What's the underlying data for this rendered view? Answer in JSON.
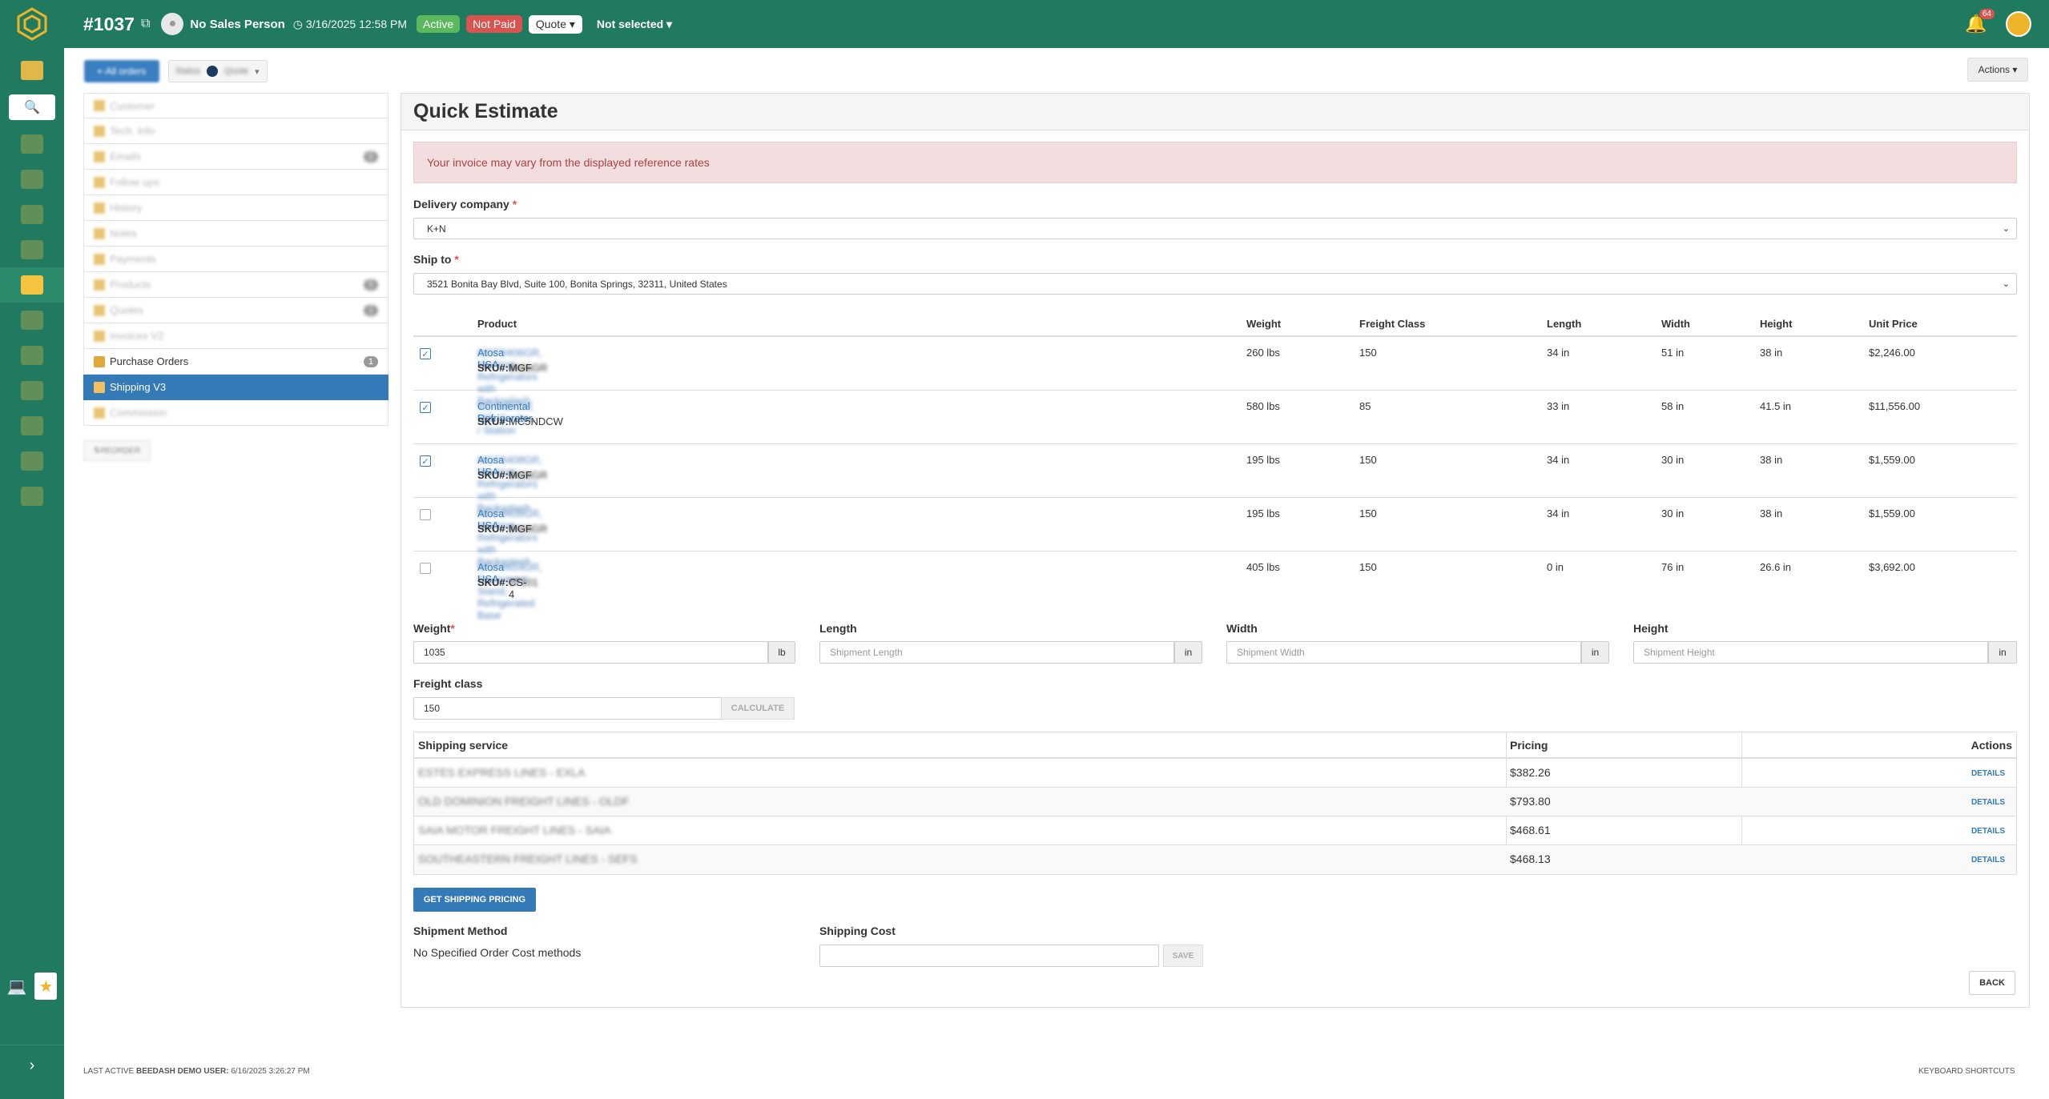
{
  "header": {
    "order_number": "#1037",
    "sales_person": "No Sales Person",
    "date": "3/16/2025 12:58 PM",
    "status_active": "Active",
    "status_paid": "Not Paid",
    "quote_label": "Quote",
    "not_selected": "Not selected",
    "notification_count": "64"
  },
  "subheader": {
    "all_orders": "All orders",
    "status_label": "Status",
    "status_value": "Quote",
    "actions": "Actions"
  },
  "sidemenu": {
    "items": [
      {
        "label": "Customer",
        "count": ""
      },
      {
        "label": "Tech. Info",
        "count": ""
      },
      {
        "label": "Emails",
        "count": "0"
      },
      {
        "label": "Follow ups",
        "count": ""
      },
      {
        "label": "History",
        "count": ""
      },
      {
        "label": "Notes",
        "count": ""
      },
      {
        "label": "Payments",
        "count": ""
      },
      {
        "label": "Products",
        "count": "5"
      },
      {
        "label": "Quotes",
        "count": "1"
      },
      {
        "label": "Invoices V2",
        "count": ""
      },
      {
        "label": "Purchase Orders",
        "count": "1"
      },
      {
        "label": "Shipping V3",
        "count": ""
      },
      {
        "label": "Commission",
        "count": ""
      }
    ],
    "reorder": "REORDER"
  },
  "panel": {
    "title": "Quick Estimate",
    "alert": "Your invoice may vary from the displayed reference rates",
    "delivery_label": "Delivery company",
    "delivery_value": "K+N",
    "shipto_label": "Ship to",
    "shipto_value": "3521 Bonita Bay Blvd, Suite 100, Bonita Springs, 32311, United States"
  },
  "product_table": {
    "headers": [
      "Product",
      "Weight",
      "Freight Class",
      "Length",
      "Width",
      "Height",
      "Unit Price"
    ],
    "rows": [
      {
        "checked": true,
        "brand": "Atosa USA,",
        "desc": "MGF8406GR, Worktop Refrigerators with Backsplash",
        "sku_label": "SKU#:",
        "sku": "MGF",
        "sku_hidden": "8406GR",
        "weight": "260 lbs",
        "freight": "150",
        "length": "34 in",
        "width": "51 in",
        "height": "38 in",
        "price": "$2,246.00"
      },
      {
        "checked": true,
        "brand": "Continental Refrigerator,",
        "desc": "MC5NDCW, Milk Cooler / Station",
        "sku_label": "SKU#:",
        "sku": "MC5NDCW",
        "sku_hidden": "",
        "weight": "580 lbs",
        "freight": "85",
        "length": "33 in",
        "width": "58 in",
        "height": "41.5 in",
        "price": "$11,556.00"
      },
      {
        "checked": true,
        "brand": "Atosa USA,",
        "desc": "MGF8408GR, Worktop Refrigerators with Backsplash",
        "sku_label": "SKU#:",
        "sku": "MGF",
        "sku_hidden": "8408GR",
        "weight": "195 lbs",
        "freight": "150",
        "length": "34 in",
        "width": "30 in",
        "height": "38 in",
        "price": "$1,559.00"
      },
      {
        "checked": false,
        "brand": "Atosa USA,",
        "desc": "MGF8408GR, Worktop Refrigerators with Backsplash",
        "sku_label": "SKU#:",
        "sku": "MGF",
        "sku_hidden": "8408GR",
        "weight": "195 lbs",
        "freight": "150",
        "length": "34 in",
        "width": "30 in",
        "height": "38 in",
        "price": "$1,559.00"
      },
      {
        "checked": false,
        "brand": "Atosa USA,",
        "desc": "MGF8454GR, Equipment Stand, Refrigerated Base",
        "sku_label": "SKU#:",
        "sku": "CS-4",
        "sku_hidden": "0T101",
        "weight": "405 lbs",
        "freight": "150",
        "length": "0 in",
        "width": "76 in",
        "height": "26.6 in",
        "price": "$3,692.00"
      }
    ]
  },
  "dimensions": {
    "weight_label": "Weight",
    "weight_value": "1035",
    "weight_unit": "lb",
    "length_label": "Length",
    "length_placeholder": "Shipment Length",
    "length_unit": "in",
    "width_label": "Width",
    "width_placeholder": "Shipment Width",
    "width_unit": "in",
    "height_label": "Height",
    "height_placeholder": "Shipment Height",
    "height_unit": "in",
    "freight_label": "Freight class",
    "freight_value": "150",
    "calculate": "CALCULATE"
  },
  "shipping_table": {
    "headers": [
      "Shipping service",
      "Pricing",
      "Actions"
    ],
    "rows": [
      {
        "service": "ESTES EXPRESS LINES - EXLA",
        "price": "$382.26",
        "action": "DETAILS"
      },
      {
        "service": "OLD DOMINION FREIGHT LINES - OLDF",
        "price": "$793.80",
        "action": "DETAILS"
      },
      {
        "service": "SAIA MOTOR FREIGHT LINES - SAIA",
        "price": "$468.61",
        "action": "DETAILS"
      },
      {
        "service": "SOUTHEASTERN FREIGHT LINES - SEFS",
        "price": "$468.13",
        "action": "DETAILS"
      }
    ]
  },
  "bottom": {
    "get_shipping": "GET SHIPPING PRICING",
    "method_label": "Shipment Method",
    "method_value": "No Specified Order Cost methods",
    "cost_label": "Shipping Cost",
    "save": "SAVE",
    "back": "BACK"
  },
  "footer": {
    "last_active": "LAST ACTIVE",
    "user": "BEEDASH DEMO USER:",
    "time": "6/16/2025 3:26:27 PM",
    "shortcuts": "KEYBOARD SHORTCUTS"
  },
  "colors": {
    "brand_green": "#207a5f",
    "link_blue": "#337ab7",
    "active_green": "#5cb85c",
    "danger_red": "#d9534f"
  }
}
